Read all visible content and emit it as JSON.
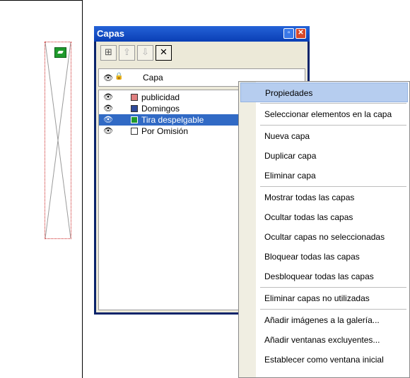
{
  "panel": {
    "title": "Capas",
    "min_glyph": "▫",
    "close_glyph": "✕",
    "column_label": "Capa",
    "toolbar": [
      {
        "name": "new-layer-icon",
        "glyph": "⊞",
        "state": "enabled"
      },
      {
        "name": "move-up-icon",
        "glyph": "⇪",
        "state": "disabled"
      },
      {
        "name": "move-down-icon",
        "glyph": "⇩",
        "state": "disabled"
      },
      {
        "name": "delete-layer-icon",
        "glyph": "✕",
        "state": "active"
      }
    ],
    "layers": [
      {
        "name": "publicidad",
        "color": "#e08080",
        "selected": false
      },
      {
        "name": "Domingos",
        "color": "#2f4b9a",
        "selected": false
      },
      {
        "name": "Tira despelgable",
        "color": "#1f9a2c",
        "selected": true
      },
      {
        "name": "Por Omisión",
        "color": "#ffffff",
        "selected": false
      }
    ]
  },
  "context_menu": {
    "items": [
      {
        "label": "Propiedades",
        "highlighted": true,
        "sep_after": true
      },
      {
        "label": "Seleccionar elementos en la capa",
        "sep_after": true
      },
      {
        "label": "Nueva capa"
      },
      {
        "label": "Duplicar capa"
      },
      {
        "label": "Eliminar capa",
        "sep_after": true
      },
      {
        "label": "Mostrar todas las capas"
      },
      {
        "label": "Ocultar todas las capas"
      },
      {
        "label": "Ocultar capas no seleccionadas"
      },
      {
        "label": "Bloquear todas las capas"
      },
      {
        "label": "Desbloquear todas las capas",
        "sep_after": true
      },
      {
        "label": "Eliminar capas no utilizadas",
        "sep_after": true
      },
      {
        "label": "Añadir imágenes a la galería..."
      },
      {
        "label": "Añadir ventanas excluyentes..."
      },
      {
        "label": "Establecer como ventana inicial"
      }
    ]
  },
  "colors": {
    "titlebar": "#0a3fb5",
    "selection": "#316ac5",
    "menu_highlight": "#b6cdef"
  }
}
